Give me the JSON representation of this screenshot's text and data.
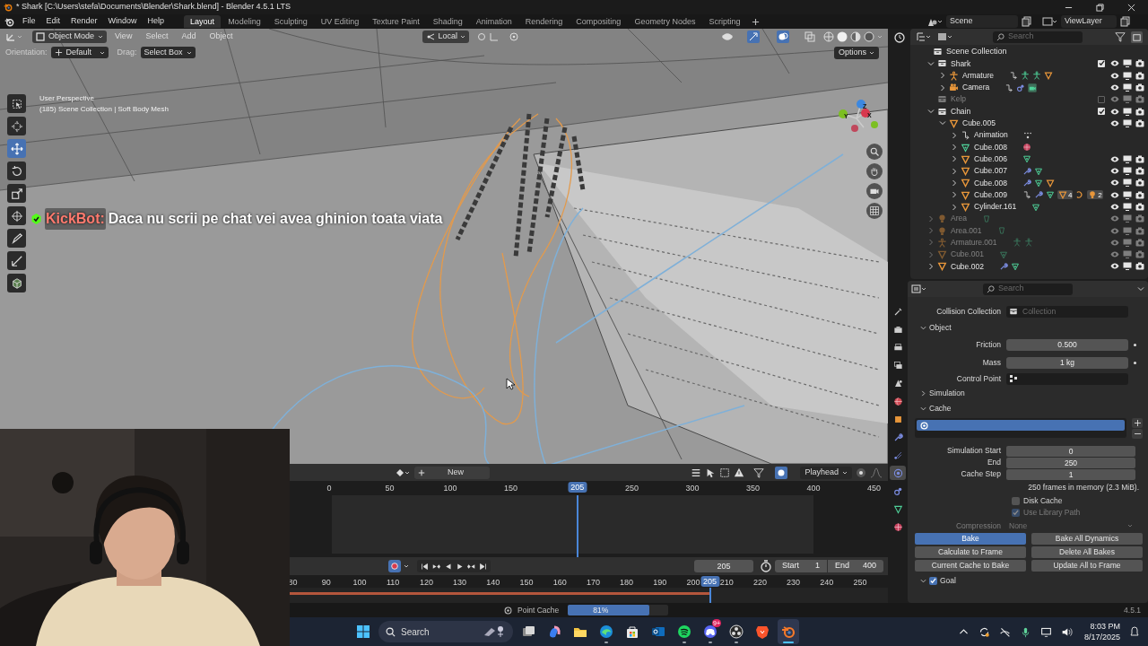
{
  "window": {
    "title": "* Shark [C:\\Users\\stefa\\Documents\\Blender\\Shark.blend] - Blender 4.5.1 LTS"
  },
  "menu": [
    "File",
    "Edit",
    "Render",
    "Window",
    "Help"
  ],
  "workspaces": [
    {
      "label": "Layout",
      "selected": true
    },
    {
      "label": "Modeling",
      "selected": false
    },
    {
      "label": "Sculpting",
      "selected": false
    },
    {
      "label": "UV Editing",
      "selected": false
    },
    {
      "label": "Texture Paint",
      "selected": false
    },
    {
      "label": "Shading",
      "selected": false
    },
    {
      "label": "Animation",
      "selected": false
    },
    {
      "label": "Rendering",
      "selected": false
    },
    {
      "label": "Compositing",
      "selected": false
    },
    {
      "label": "Geometry Nodes",
      "selected": false
    },
    {
      "label": "Scripting",
      "selected": false
    }
  ],
  "scene": {
    "scene": "Scene",
    "view_layer": "ViewLayer"
  },
  "viewport": {
    "mode": "Object Mode",
    "menus": [
      "View",
      "Select",
      "Add",
      "Object"
    ],
    "pivot": "Local",
    "orientation_label": "Orientation:",
    "orientation": "Default",
    "drag_label": "Drag:",
    "drag": "Select Box",
    "options": "Options",
    "view_name": "User Perspective",
    "info": "(185) Scene Collection | Soft Body Mesh",
    "gizmo": [
      "X",
      "Y",
      "Z"
    ],
    "tools": [
      {
        "kind": "select",
        "selected": false
      },
      {
        "kind": "cursor",
        "selected": false
      },
      {
        "kind": "move",
        "selected": true
      },
      {
        "kind": "rotate",
        "selected": false
      },
      {
        "kind": "scale",
        "selected": false
      },
      {
        "kind": "transform",
        "selected": false
      },
      {
        "kind": "annotate",
        "selected": false
      },
      {
        "kind": "measure",
        "selected": false
      },
      {
        "kind": "add_cube",
        "selected": false
      }
    ]
  },
  "chat_overlay": {
    "user": "KickBot:",
    "message": "Daca nu scrii pe chat vei avea ghinion toata viata"
  },
  "outliner": {
    "search": "Search",
    "tree": [
      {
        "name": "Scene Collection",
        "kind": "scene_collection",
        "faded": false,
        "restrict": false,
        "children": [
          {
            "name": "Shark",
            "kind": "collection",
            "expanded": true,
            "included": true,
            "faded": false,
            "restrict": true,
            "children": [
              {
                "name": "Armature",
                "kind": "armature",
                "expanded": false,
                "faded": false,
                "restrict": true,
                "tags": [
                  {
                    "kind": "action"
                  },
                  {
                    "kind": "pose"
                  },
                  {
                    "kind": "pose"
                  },
                  {
                    "kind": "mesh_object"
                  }
                ]
              },
              {
                "name": "Camera",
                "kind": "camera",
                "expanded": false,
                "faded": false,
                "restrict": true,
                "tags": [
                  {
                    "kind": "action"
                  },
                  {
                    "kind": "constraint"
                  },
                  {
                    "kind": "camera_data"
                  }
                ]
              }
            ]
          },
          {
            "name": "Kelp",
            "kind": "collection",
            "included": false,
            "faded": true,
            "restrict": true
          },
          {
            "name": "Chain",
            "kind": "collection",
            "expanded": true,
            "included": true,
            "faded": false,
            "restrict": true,
            "children": [
              {
                "name": "Cube.005",
                "kind": "mesh_object",
                "expanded": true,
                "faded": false,
                "restrict": true,
                "children": [
                  {
                    "name": "Animation",
                    "kind": "action",
                    "expanded": false,
                    "faded": false,
                    "restrict": false,
                    "tags": [
                      {
                        "kind": "drivers"
                      }
                    ]
                  },
                  {
                    "name": "Cube.008",
                    "kind": "mesh_data",
                    "expanded": false,
                    "faded": false,
                    "restrict": false,
                    "tags": [
                      {
                        "kind": "material"
                      }
                    ]
                  },
                  {
                    "name": "Cube.006",
                    "kind": "mesh_object",
                    "expanded": false,
                    "faded": false,
                    "restrict": true,
                    "tags": [
                      {
                        "kind": "mesh_data"
                      }
                    ]
                  },
                  {
                    "name": "Cube.007",
                    "kind": "mesh_object",
                    "expanded": false,
                    "faded": false,
                    "restrict": true,
                    "tags": [
                      {
                        "kind": "modifier"
                      },
                      {
                        "kind": "mesh_data"
                      }
                    ]
                  },
                  {
                    "name": "Cube.008",
                    "kind": "mesh_object",
                    "expanded": false,
                    "faded": false,
                    "restrict": true,
                    "tags": [
                      {
                        "kind": "modifier"
                      },
                      {
                        "kind": "mesh_data"
                      },
                      {
                        "kind": "mesh_object"
                      }
                    ]
                  },
                  {
                    "name": "Cube.009",
                    "kind": "mesh_object",
                    "expanded": false,
                    "faded": false,
                    "restrict": true,
                    "tags": [
                      {
                        "kind": "action"
                      },
                      {
                        "kind": "modifier"
                      },
                      {
                        "kind": "mesh_data"
                      },
                      {
                        "kind": "mesh_object",
                        "count": "4"
                      },
                      {
                        "kind": "hook"
                      },
                      {
                        "kind": "light",
                        "count": "2"
                      }
                    ]
                  },
                  {
                    "name": "Cylinder.161",
                    "kind": "mesh_object",
                    "expanded": false,
                    "faded": false,
                    "restrict": true,
                    "tags": [
                      {
                        "kind": "mesh_data"
                      }
                    ]
                  }
                ]
              }
            ]
          },
          {
            "name": "Area",
            "kind": "light",
            "expanded": false,
            "faded": true,
            "restrict": true,
            "tags": [
              {
                "kind": "light_data"
              }
            ]
          },
          {
            "name": "Area.001",
            "kind": "light",
            "expanded": false,
            "faded": true,
            "restrict": true,
            "tags": [
              {
                "kind": "light_data"
              }
            ]
          },
          {
            "name": "Armature.001",
            "kind": "armature",
            "expanded": false,
            "faded": true,
            "restrict": true,
            "tags": [
              {
                "kind": "pose"
              },
              {
                "kind": "pose"
              }
            ]
          },
          {
            "name": "Cube.001",
            "kind": "mesh_object",
            "expanded": false,
            "faded": true,
            "restrict": true,
            "tags": [
              {
                "kind": "mesh_data"
              }
            ]
          },
          {
            "name": "Cube.002",
            "kind": "mesh_object",
            "expanded": false,
            "faded": false,
            "restrict": true,
            "tags": [
              {
                "kind": "modifier"
              },
              {
                "kind": "mesh_data"
              }
            ]
          }
        ]
      }
    ]
  },
  "properties": {
    "search": "Search",
    "tabs": [
      {
        "kind": "tool",
        "selected": false
      },
      {
        "kind": "render",
        "selected": false
      },
      {
        "kind": "output",
        "selected": false
      },
      {
        "kind": "view_layer",
        "selected": false
      },
      {
        "kind": "scene",
        "selected": false
      },
      {
        "kind": "world",
        "selected": false
      },
      {
        "kind": "object",
        "selected": false
      },
      {
        "kind": "modifiers",
        "selected": false
      },
      {
        "kind": "particles",
        "selected": false
      },
      {
        "kind": "physics",
        "selected": true
      },
      {
        "kind": "constraints",
        "selected": false
      },
      {
        "kind": "data",
        "selected": false
      },
      {
        "kind": "material",
        "selected": false
      }
    ],
    "rows": [
      {
        "kind": "collection_field",
        "label": "Collision Collection",
        "placeholder": "Collection"
      },
      {
        "kind": "section",
        "label": "Object",
        "expanded": true
      },
      {
        "kind": "number",
        "label": "Friction",
        "value": "0.500",
        "decorator": true
      },
      {
        "kind": "number",
        "label": "Mass",
        "value": "1 kg",
        "decorator": true
      },
      {
        "kind": "group_field",
        "label": "Control Point"
      },
      {
        "kind": "section",
        "label": "Simulation",
        "expanded": false
      },
      {
        "kind": "section",
        "label": "Cache",
        "expanded": true
      },
      {
        "kind": "cache_list"
      },
      {
        "kind": "number_stack",
        "label": "Simulation Start",
        "value": "0"
      },
      {
        "kind": "number_stack",
        "label": "End",
        "value": "250"
      },
      {
        "kind": "number_stack",
        "label": "Cache Step",
        "value": "1"
      },
      {
        "kind": "info",
        "text": "250 frames in memory (2.3 MiB)."
      },
      {
        "kind": "checkbox",
        "label": "Disk Cache",
        "checked": false,
        "disabled": false
      },
      {
        "kind": "checkbox",
        "label": "Use Library Path",
        "checked": true,
        "disabled": true
      },
      {
        "kind": "dropdown",
        "label": "Compression",
        "value": "None",
        "disabled": true
      },
      {
        "kind": "buttons",
        "items": [
          {
            "label": "Bake",
            "selected": true
          },
          {
            "label": "Bake All Dynamics",
            "selected": false
          }
        ]
      },
      {
        "kind": "buttons",
        "items": [
          {
            "label": "Calculate to Frame",
            "selected": false
          },
          {
            "label": "Delete All Bakes",
            "selected": false
          }
        ]
      },
      {
        "kind": "buttons",
        "items": [
          {
            "label": "Current Cache to Bake",
            "selected": false
          },
          {
            "label": "Update All to Frame",
            "selected": false
          }
        ]
      },
      {
        "kind": "check_section",
        "label": "Goal",
        "expanded": true,
        "checked": true
      }
    ]
  },
  "timeline": {
    "new": "New",
    "playhead": "Playhead",
    "ruler": [
      "0",
      "50",
      "100",
      "150",
      "250",
      "300",
      "350",
      "400",
      "450"
    ],
    "current": "205",
    "frame": "205",
    "start_label": "Start",
    "start": "1",
    "end_label": "End",
    "end": "400",
    "cache_ruler": [
      "80",
      "90",
      "100",
      "110",
      "120",
      "130",
      "140",
      "150",
      "160",
      "170",
      "180",
      "190",
      "200",
      "210",
      "220",
      "230",
      "240",
      "250"
    ],
    "cache_current": "205"
  },
  "status_bar": {
    "task": "Point Cache",
    "progress": {
      "label": "81%",
      "level": 0.81
    },
    "version": "4.5.1"
  },
  "taskbar": {
    "search": "Search",
    "time": "8:03 PM",
    "date": "8/17/2025",
    "apps": [
      {
        "kind": "task_view",
        "running": false,
        "selected": false
      },
      {
        "kind": "copilot",
        "running": false,
        "selected": false
      },
      {
        "kind": "files",
        "running": false,
        "selected": false
      },
      {
        "kind": "edge",
        "running": true,
        "selected": false
      },
      {
        "kind": "store",
        "running": false,
        "selected": false
      },
      {
        "kind": "outlook",
        "running": false,
        "selected": false
      },
      {
        "kind": "spotify",
        "running": true,
        "selected": false
      },
      {
        "kind": "discord",
        "running": true,
        "selected": false,
        "badge": "9+"
      },
      {
        "kind": "obs",
        "running": true,
        "selected": false
      },
      {
        "kind": "brave",
        "running": false,
        "selected": false
      },
      {
        "kind": "blender",
        "running": true,
        "selected": true
      }
    ]
  }
}
